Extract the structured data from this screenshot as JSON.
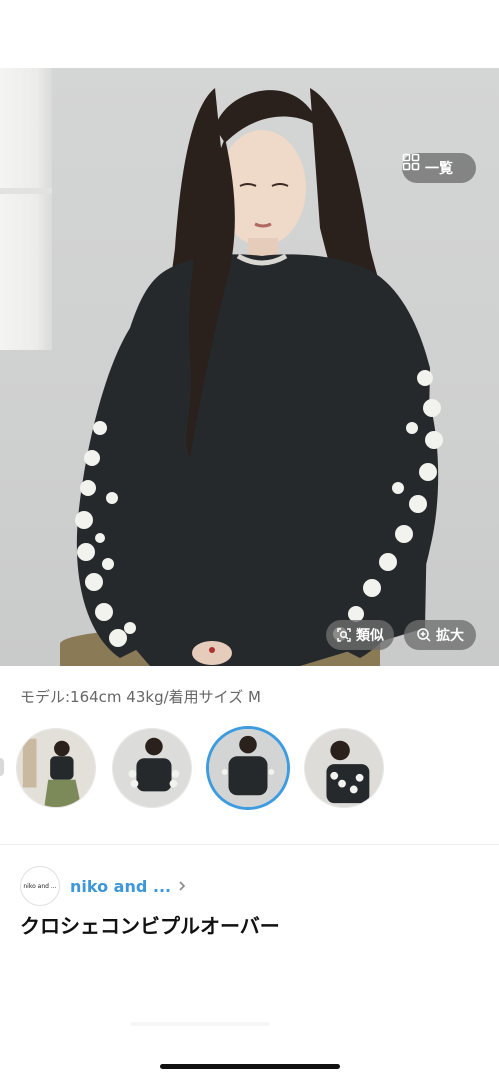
{
  "hero": {
    "list_button": {
      "label": "一覧",
      "icon": "grid-icon"
    },
    "similar_button": {
      "label": "類似",
      "icon": "image-search-icon"
    },
    "zoom_button": {
      "label": "拡大",
      "icon": "zoom-in-icon"
    }
  },
  "model_info": "モデル:164cm 43kg/着用サイズ M",
  "thumbnails": {
    "count": 4,
    "selected_index": 2
  },
  "brand": {
    "logo_text": "niko and ...",
    "name": "niko and ...",
    "icon": "chevron-right-icon"
  },
  "product": {
    "title": "クロシェコンビプルオーバー"
  },
  "colors": {
    "accent": "#3d9be0",
    "brand_link": "#3d97d8",
    "sweater": "#26292c",
    "pattern": "#f2f2ee"
  }
}
